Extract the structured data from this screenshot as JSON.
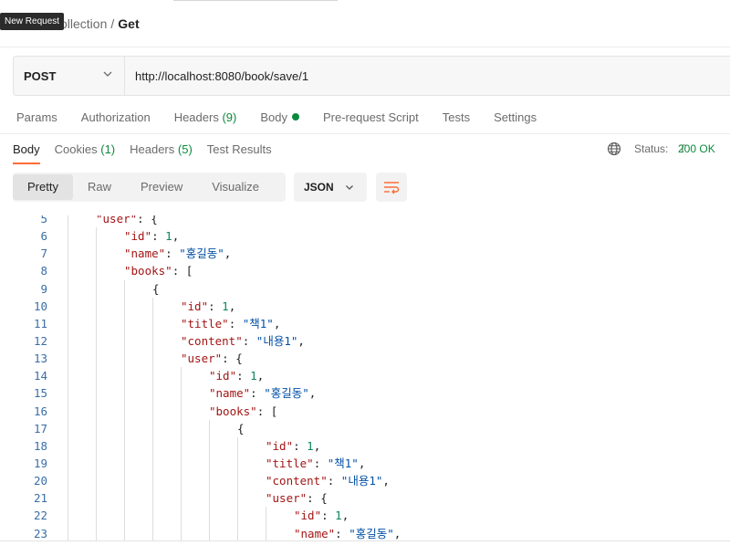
{
  "tooltip": "New Request",
  "breadcrumb": {
    "parent": "ollection",
    "separator": "/",
    "current": "Get"
  },
  "request": {
    "method": "POST",
    "url": "http://localhost:8080/book/save/1"
  },
  "request_tabs": [
    {
      "label": "Params"
    },
    {
      "label": "Authorization"
    },
    {
      "label": "Headers",
      "count": "(9)"
    },
    {
      "label": "Body"
    },
    {
      "label": "Pre-request Script"
    },
    {
      "label": "Tests"
    },
    {
      "label": "Settings"
    }
  ],
  "response_tabs": [
    {
      "label": "Body"
    },
    {
      "label": "Cookies",
      "count": "(1)"
    },
    {
      "label": "Headers",
      "count": "(5)"
    },
    {
      "label": "Test Results"
    }
  ],
  "status": {
    "label": "Status:",
    "code": "200 OK",
    "trail": "T"
  },
  "view_modes": [
    "Pretty",
    "Raw",
    "Preview",
    "Visualize"
  ],
  "format": "JSON",
  "colors": {
    "accent": "#ff6c37",
    "success": "#0b8a3e",
    "key": "#a31515",
    "string": "#0451a5",
    "number": "#098658",
    "line_number": "#3a6ea5"
  },
  "code_lines": [
    {
      "n": "5",
      "depth": 1,
      "tokens": [
        [
          "k",
          "\"user\""
        ],
        [
          "p",
          ": {"
        ]
      ]
    },
    {
      "n": "6",
      "depth": 2,
      "tokens": [
        [
          "k",
          "\"id\""
        ],
        [
          "p",
          ": "
        ],
        [
          "n",
          "1"
        ],
        [
          "p",
          ","
        ]
      ]
    },
    {
      "n": "7",
      "depth": 2,
      "tokens": [
        [
          "k",
          "\"name\""
        ],
        [
          "p",
          ": "
        ],
        [
          "s",
          "\"홍길동\""
        ],
        [
          "p",
          ","
        ]
      ]
    },
    {
      "n": "8",
      "depth": 2,
      "tokens": [
        [
          "k",
          "\"books\""
        ],
        [
          "p",
          ": ["
        ]
      ]
    },
    {
      "n": "9",
      "depth": 3,
      "tokens": [
        [
          "p",
          "{"
        ]
      ]
    },
    {
      "n": "10",
      "depth": 4,
      "tokens": [
        [
          "k",
          "\"id\""
        ],
        [
          "p",
          ": "
        ],
        [
          "n",
          "1"
        ],
        [
          "p",
          ","
        ]
      ]
    },
    {
      "n": "11",
      "depth": 4,
      "tokens": [
        [
          "k",
          "\"title\""
        ],
        [
          "p",
          ": "
        ],
        [
          "s",
          "\"책1\""
        ],
        [
          "p",
          ","
        ]
      ]
    },
    {
      "n": "12",
      "depth": 4,
      "tokens": [
        [
          "k",
          "\"content\""
        ],
        [
          "p",
          ": "
        ],
        [
          "s",
          "\"내용1\""
        ],
        [
          "p",
          ","
        ]
      ]
    },
    {
      "n": "13",
      "depth": 4,
      "tokens": [
        [
          "k",
          "\"user\""
        ],
        [
          "p",
          ": {"
        ]
      ]
    },
    {
      "n": "14",
      "depth": 5,
      "tokens": [
        [
          "k",
          "\"id\""
        ],
        [
          "p",
          ": "
        ],
        [
          "n",
          "1"
        ],
        [
          "p",
          ","
        ]
      ]
    },
    {
      "n": "15",
      "depth": 5,
      "tokens": [
        [
          "k",
          "\"name\""
        ],
        [
          "p",
          ": "
        ],
        [
          "s",
          "\"홍길동\""
        ],
        [
          "p",
          ","
        ]
      ]
    },
    {
      "n": "16",
      "depth": 5,
      "tokens": [
        [
          "k",
          "\"books\""
        ],
        [
          "p",
          ": ["
        ]
      ]
    },
    {
      "n": "17",
      "depth": 6,
      "tokens": [
        [
          "p",
          "{"
        ]
      ]
    },
    {
      "n": "18",
      "depth": 7,
      "tokens": [
        [
          "k",
          "\"id\""
        ],
        [
          "p",
          ": "
        ],
        [
          "n",
          "1"
        ],
        [
          "p",
          ","
        ]
      ]
    },
    {
      "n": "19",
      "depth": 7,
      "tokens": [
        [
          "k",
          "\"title\""
        ],
        [
          "p",
          ": "
        ],
        [
          "s",
          "\"책1\""
        ],
        [
          "p",
          ","
        ]
      ]
    },
    {
      "n": "20",
      "depth": 7,
      "tokens": [
        [
          "k",
          "\"content\""
        ],
        [
          "p",
          ": "
        ],
        [
          "s",
          "\"내용1\""
        ],
        [
          "p",
          ","
        ]
      ]
    },
    {
      "n": "21",
      "depth": 7,
      "tokens": [
        [
          "k",
          "\"user\""
        ],
        [
          "p",
          ": {"
        ]
      ]
    },
    {
      "n": "22",
      "depth": 8,
      "tokens": [
        [
          "k",
          "\"id\""
        ],
        [
          "p",
          ": "
        ],
        [
          "n",
          "1"
        ],
        [
          "p",
          ","
        ]
      ]
    },
    {
      "n": "23",
      "depth": 8,
      "tokens": [
        [
          "k",
          "\"name\""
        ],
        [
          "p",
          ": "
        ],
        [
          "s",
          "\"홍길동\""
        ],
        [
          "p",
          ","
        ]
      ]
    }
  ]
}
